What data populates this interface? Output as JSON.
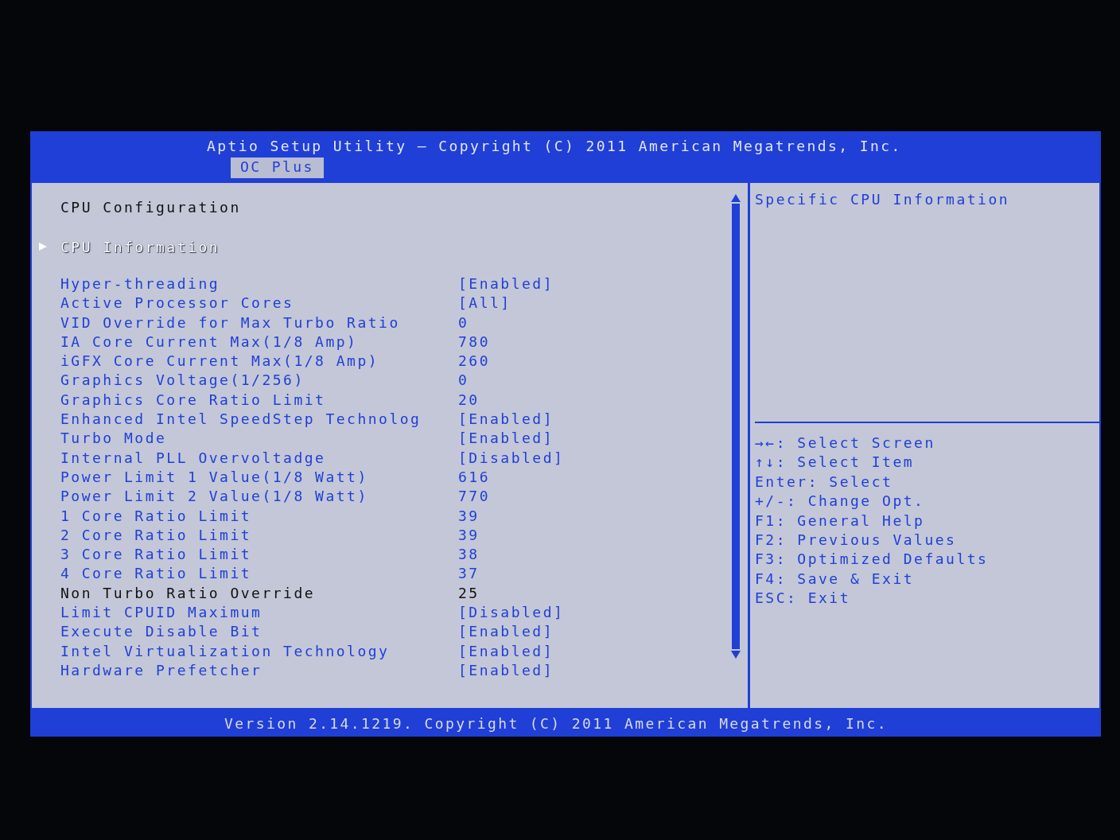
{
  "header": {
    "title": "Aptio Setup Utility – Copyright (C) 2011 American Megatrends, Inc.",
    "tabs": [
      {
        "label": "OC Plus",
        "selected": true
      }
    ]
  },
  "page": {
    "title": "CPU Configuration",
    "items": [
      {
        "kind": "submenu",
        "label": "CPU Information",
        "selected": true
      },
      {
        "kind": "option",
        "label": "Hyper-threading",
        "value": "[Enabled]",
        "editable": true,
        "selected": false
      },
      {
        "kind": "option",
        "label": "Active Processor Cores",
        "value": "[All]",
        "editable": true,
        "selected": false
      },
      {
        "kind": "option",
        "label": "VID Override for Max Turbo Ratio",
        "value": "0",
        "editable": true,
        "selected": false
      },
      {
        "kind": "option",
        "label": "IA Core Current Max(1/8 Amp)",
        "value": "780",
        "editable": true,
        "selected": false
      },
      {
        "kind": "option",
        "label": "iGFX Core Current Max(1/8 Amp)",
        "value": "260",
        "editable": true,
        "selected": false
      },
      {
        "kind": "option",
        "label": "Graphics Voltage(1/256)",
        "value": "0",
        "editable": true,
        "selected": false
      },
      {
        "kind": "option",
        "label": "Graphics Core Ratio Limit",
        "value": "20",
        "editable": true,
        "selected": false
      },
      {
        "kind": "option",
        "label": "Enhanced Intel SpeedStep Technolog",
        "value": "[Enabled]",
        "editable": true,
        "selected": false
      },
      {
        "kind": "option",
        "label": "Turbo Mode",
        "value": "[Enabled]",
        "editable": true,
        "selected": false
      },
      {
        "kind": "option",
        "label": "Internal PLL Overvoltadge",
        "value": "[Disabled]",
        "editable": true,
        "selected": false
      },
      {
        "kind": "option",
        "label": "Power Limit 1 Value(1/8 Watt)",
        "value": "616",
        "editable": true,
        "selected": false
      },
      {
        "kind": "option",
        "label": "Power Limit 2 Value(1/8 Watt)",
        "value": "770",
        "editable": true,
        "selected": false
      },
      {
        "kind": "option",
        "label": "1 Core Ratio Limit",
        "value": "39",
        "editable": true,
        "selected": false
      },
      {
        "kind": "option",
        "label": "2 Core Ratio Limit",
        "value": "39",
        "editable": true,
        "selected": false
      },
      {
        "kind": "option",
        "label": "3 Core Ratio Limit",
        "value": "38",
        "editable": true,
        "selected": false
      },
      {
        "kind": "option",
        "label": "4 Core Ratio Limit",
        "value": "37",
        "editable": true,
        "selected": false
      },
      {
        "kind": "option",
        "label": "Non Turbo Ratio Override",
        "value": "25",
        "editable": false,
        "selected": false
      },
      {
        "kind": "option",
        "label": "Limit CPUID Maximum",
        "value": "[Disabled]",
        "editable": true,
        "selected": false
      },
      {
        "kind": "option",
        "label": "Execute Disable Bit",
        "value": "[Enabled]",
        "editable": true,
        "selected": false
      },
      {
        "kind": "option",
        "label": "Intel Virtualization Technology",
        "value": "[Enabled]",
        "editable": true,
        "selected": false
      },
      {
        "kind": "option",
        "label": "Hardware Prefetcher",
        "value": "[Enabled]",
        "editable": true,
        "selected": false
      }
    ]
  },
  "help": {
    "text": "Specific CPU Information",
    "keys": [
      "→←: Select Screen",
      "↑↓: Select Item",
      "Enter: Select",
      "+/-: Change Opt.",
      "F1: General Help",
      "F2: Previous Values",
      "F3: Optimized Defaults",
      "F4: Save & Exit",
      "ESC: Exit"
    ]
  },
  "footer": "Version 2.14.1219. Copyright (C) 2011 American Megatrends, Inc."
}
